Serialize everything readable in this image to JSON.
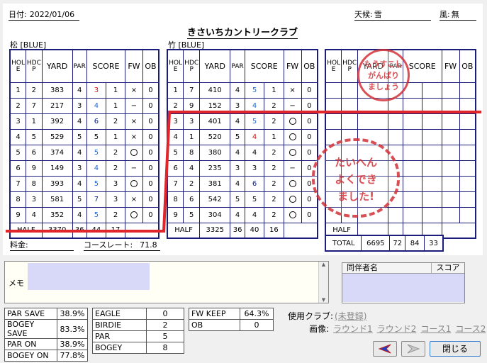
{
  "header": {
    "date_label": "日付:",
    "date": "2022/01/06",
    "course_name": "きさいちカントリークラブ",
    "weather_label": "天候:",
    "weather": "雪",
    "wind_label": "風:",
    "wind": "無"
  },
  "columns": [
    "HOLE",
    "HDCP",
    "YARD",
    "PAR",
    "SCORE",
    "FW",
    "OB"
  ],
  "round1": {
    "label": "松 [BLUE]",
    "rows": [
      {
        "hole": "1",
        "hdcp": "2",
        "yard": "383",
        "par": "4",
        "score": "3",
        "putt": "1",
        "fw": "×",
        "ob": "0",
        "color": "red"
      },
      {
        "hole": "2",
        "hdcp": "7",
        "yard": "217",
        "par": "3",
        "score": "4",
        "putt": "1",
        "fw": "−",
        "ob": "0",
        "color": "blue"
      },
      {
        "hole": "3",
        "hdcp": "1",
        "yard": "392",
        "par": "4",
        "score": "6",
        "putt": "2",
        "fw": "×",
        "ob": "0",
        "color": "navy"
      },
      {
        "hole": "4",
        "hdcp": "5",
        "yard": "529",
        "par": "5",
        "score": "5",
        "putt": "1",
        "fw": "×",
        "ob": "0",
        "color": "black"
      },
      {
        "hole": "5",
        "hdcp": "6",
        "yard": "374",
        "par": "4",
        "score": "5",
        "putt": "2",
        "fw": "○",
        "ob": "0",
        "color": "blue"
      },
      {
        "hole": "6",
        "hdcp": "9",
        "yard": "149",
        "par": "3",
        "score": "4",
        "putt": "2",
        "fw": "−",
        "ob": "0",
        "color": "blue"
      },
      {
        "hole": "7",
        "hdcp": "8",
        "yard": "393",
        "par": "4",
        "score": "5",
        "putt": "3",
        "fw": "○",
        "ob": "0",
        "color": "blue"
      },
      {
        "hole": "8",
        "hdcp": "3",
        "yard": "581",
        "par": "5",
        "score": "7",
        "putt": "3",
        "fw": "×",
        "ob": "0",
        "color": "navy"
      },
      {
        "hole": "9",
        "hdcp": "4",
        "yard": "352",
        "par": "4",
        "score": "5",
        "putt": "2",
        "fw": "○",
        "ob": "0",
        "color": "blue"
      }
    ],
    "half": {
      "label": "HALF",
      "yard": "3370",
      "par": "36",
      "score": "44",
      "putt": "17"
    }
  },
  "round2": {
    "label": "竹 [BLUE]",
    "rows": [
      {
        "hole": "1",
        "hdcp": "7",
        "yard": "410",
        "par": "4",
        "score": "5",
        "putt": "1",
        "fw": "×",
        "ob": "0",
        "color": "blue"
      },
      {
        "hole": "2",
        "hdcp": "9",
        "yard": "152",
        "par": "3",
        "score": "4",
        "putt": "2",
        "fw": "−",
        "ob": "0",
        "color": "blue"
      },
      {
        "hole": "3",
        "hdcp": "3",
        "yard": "401",
        "par": "4",
        "score": "5",
        "putt": "2",
        "fw": "○",
        "ob": "0",
        "color": "blue"
      },
      {
        "hole": "4",
        "hdcp": "1",
        "yard": "520",
        "par": "5",
        "score": "4",
        "putt": "1",
        "fw": "○",
        "ob": "0",
        "color": "red"
      },
      {
        "hole": "5",
        "hdcp": "8",
        "yard": "380",
        "par": "4",
        "score": "4",
        "putt": "2",
        "fw": "○",
        "ob": "0",
        "color": "black"
      },
      {
        "hole": "6",
        "hdcp": "4",
        "yard": "235",
        "par": "3",
        "score": "3",
        "putt": "2",
        "fw": "−",
        "ob": "0",
        "color": "black"
      },
      {
        "hole": "7",
        "hdcp": "2",
        "yard": "381",
        "par": "4",
        "score": "6",
        "putt": "2",
        "fw": "○",
        "ob": "0",
        "color": "navy"
      },
      {
        "hole": "8",
        "hdcp": "6",
        "yard": "542",
        "par": "5",
        "score": "5",
        "putt": "2",
        "fw": "○",
        "ob": "0",
        "color": "black"
      },
      {
        "hole": "9",
        "hdcp": "5",
        "yard": "304",
        "par": "4",
        "score": "4",
        "putt": "2",
        "fw": "○",
        "ob": "0",
        "color": "black"
      }
    ],
    "half": {
      "label": "HALF",
      "yard": "3325",
      "par": "36",
      "score": "40",
      "putt": "16"
    }
  },
  "round3": {
    "half_label": "HALF"
  },
  "total": {
    "label": "TOTAL",
    "yard": "6695",
    "par": "72",
    "score": "84",
    "putt": "33"
  },
  "fee_label": "料金:",
  "course_rate_label": "コースレート:",
  "course_rate": "71.8",
  "stamps": {
    "encourage_lines": [
      "もうすこし",
      "がんばり",
      "ましょう"
    ],
    "praise_lines": [
      "たいへん",
      "よくでき",
      "ました!"
    ]
  },
  "memo_label": "メモ",
  "companions": {
    "col_name": "同伴者名",
    "col_score": "スコア"
  },
  "stats_a": [
    [
      "PAR SAVE",
      "38.9%"
    ],
    [
      "BOGEY SAVE",
      "83.3%"
    ],
    [
      "PAR ON",
      "38.9%"
    ],
    [
      "BOGEY ON",
      "77.8%"
    ]
  ],
  "stats_b": [
    [
      "EAGLE",
      "0"
    ],
    [
      "BIRDIE",
      "2"
    ],
    [
      "PAR",
      "5"
    ],
    [
      "BOGEY",
      "8"
    ]
  ],
  "stats_c": [
    [
      "FW KEEP",
      "64.3%"
    ],
    [
      "OB",
      "0"
    ]
  ],
  "clubs_label": "使用クラブ:",
  "clubs_value": "(未登録)",
  "images_label": "画像:",
  "image_links": [
    "ラウンド1",
    "ラウンド2",
    "コース1",
    "コース2"
  ],
  "close_button": "閉じる",
  "colors": {
    "table_border": "#1c1c7a",
    "red_line": "#e0262b",
    "red_score": "#d01010",
    "blue_score": "#1f6ad0",
    "navy_score": "#0a1e8c",
    "memo_fill": "#d8d8f8"
  }
}
